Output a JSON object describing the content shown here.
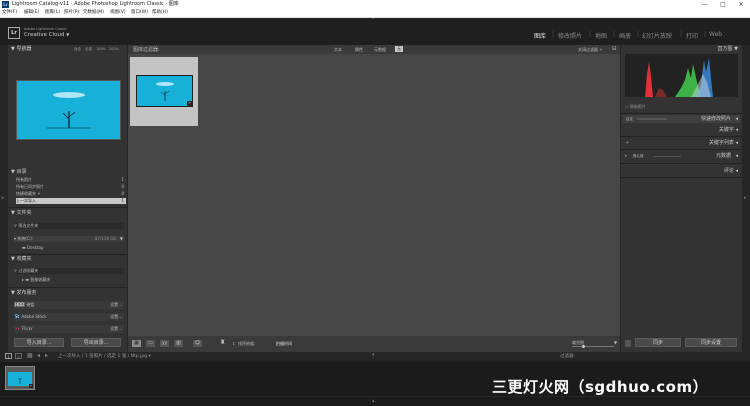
{
  "titlebar": {
    "app_icon": "Lr",
    "title": "Lightroom Catalog-v11 - Adobe Photoshop Lightroom Classic - 图库",
    "minimize": "—",
    "maximize": "□",
    "close": "✕"
  },
  "menubar": [
    "文件(F)",
    "编辑(E)",
    "图库(L)",
    "照片(P)",
    "元数据(M)",
    "视图(V)",
    "窗口(W)",
    "帮助(H)"
  ],
  "identity": {
    "logo": "Lr",
    "brand_small": "Adobe Lightroom Classic",
    "brand_big": "Creative Cloud",
    "brand_caret": "▼"
  },
  "modules": [
    {
      "label": "图库",
      "active": true
    },
    {
      "label": "修改照片",
      "active": false
    },
    {
      "label": "地图",
      "active": false
    },
    {
      "label": "画册",
      "active": false
    },
    {
      "label": "幻灯片放映",
      "active": false
    },
    {
      "label": "打印",
      "active": false
    },
    {
      "label": "Web",
      "active": false
    }
  ],
  "navigator": {
    "title": "导航器",
    "zoom_options": [
      "适合",
      "全部",
      "100%",
      "200%"
    ]
  },
  "catalog": {
    "title": "目录",
    "items": [
      {
        "label": "所有照片",
        "count": "1",
        "selected": false
      },
      {
        "label": "所有已同步照片",
        "count": "0",
        "selected": false
      },
      {
        "label": "快捷收藏夹 +",
        "count": "0",
        "selected": false
      },
      {
        "label": "上一次导入",
        "count": "1",
        "selected": true
      }
    ]
  },
  "folders": {
    "title": "文件夹",
    "filter_label": "筛选文件夹",
    "volume": "系统(C:)",
    "volume_space": "87/118 GB",
    "folder": "Desktop"
  },
  "collections": {
    "title": "收藏夹",
    "filter_label": "过滤收藏夹",
    "smart": "智能收藏夹"
  },
  "publish": {
    "title": "发布服务",
    "services": [
      {
        "icon": "HDD",
        "label": "硬盘",
        "action": "设置..."
      },
      {
        "icon": "St",
        "label": "Adobe Stock",
        "action": "设置..."
      },
      {
        "icon": "••",
        "label": "Flickr",
        "action": "设置..."
      }
    ]
  },
  "left_buttons": {
    "import": "导入目录...",
    "export": "导出目录..."
  },
  "grid": {
    "header": "图库过滤器:",
    "filters": [
      "文本",
      "属性",
      "元数据",
      "无"
    ],
    "preset": "关闭过滤器 ÷"
  },
  "toolbar": {
    "sort_label": "排序依据:",
    "sort_value": "拍摄时间",
    "thumbs_label": "缩览图"
  },
  "histogram": {
    "title": "直方图",
    "original": "原始照片"
  },
  "quick_develop": {
    "title": "快速修改照片",
    "preset_label": "自定",
    "preset_value": "默认设置"
  },
  "keywording": {
    "title": "关键字"
  },
  "keyword_list": {
    "title": "关键字列表"
  },
  "metadata": {
    "title": "元数据",
    "preset": "默认值"
  },
  "comments": {
    "title": "评论"
  },
  "right_buttons": {
    "sync": "同步",
    "sync_settings": "同步设置"
  },
  "filmstrip": {
    "tabs": [
      "1",
      "2"
    ],
    "source": "上一次导入",
    "info": "1 张照片 / 选定 1 张 / Ntp.jpg",
    "filter": "过滤器:"
  },
  "watermark": "三更灯火网（sgdhuo.com）",
  "colors": {
    "panel": "#333333",
    "grid_bg": "#464646",
    "photo_teal": "#17b0d8",
    "histogram_red": "#e0303a",
    "histogram_green": "#3ec14a",
    "histogram_blue": "#3a8ad8"
  }
}
